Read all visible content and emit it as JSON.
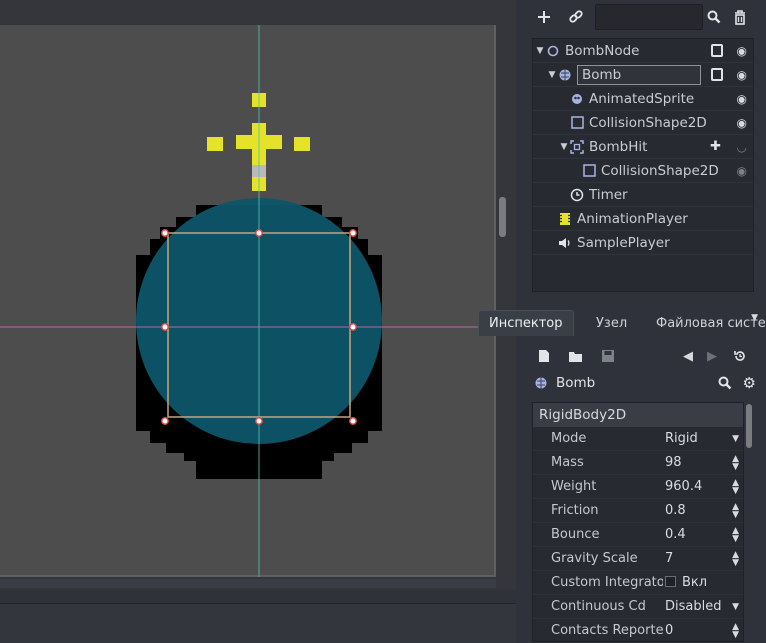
{
  "scene_tree": {
    "nodes": [
      {
        "name": "BombNode",
        "icon": "node-circle-icon",
        "has_script": true,
        "visible": true,
        "expanded": true
      },
      {
        "name": "Bomb",
        "icon": "rigidbody-globe-icon",
        "has_script": true,
        "visible": true,
        "expanded": true,
        "selected": true
      },
      {
        "name": "AnimatedSprite",
        "icon": "animated-sprite-icon",
        "visible": true
      },
      {
        "name": "CollisionShape2D",
        "icon": "collision-shape-icon",
        "visible": true
      },
      {
        "name": "BombHit",
        "icon": "area2d-icon",
        "has_lock": true,
        "visible": true,
        "expanded": true
      },
      {
        "name": "CollisionShape2D",
        "icon": "collision-shape-icon",
        "visible": true
      },
      {
        "name": "Timer",
        "icon": "timer-icon"
      },
      {
        "name": "AnimationPlayer",
        "icon": "animation-player-icon"
      },
      {
        "name": "SamplePlayer",
        "icon": "sample-player-icon"
      }
    ]
  },
  "dock_tabs": [
    {
      "label": "Инспектор",
      "active": true
    },
    {
      "label": "Узел",
      "active": false
    },
    {
      "label": "Файловая систем",
      "active": false
    }
  ],
  "inspector": {
    "object_name": "Bomb",
    "section": "RigidBody2D",
    "properties": [
      {
        "name": "Mode",
        "value": "Rigid",
        "control": "dropdown"
      },
      {
        "name": "Mass",
        "value": "98",
        "control": "spin"
      },
      {
        "name": "Weight",
        "value": "960.4",
        "control": "spin"
      },
      {
        "name": "Friction",
        "value": "0.8",
        "control": "spin"
      },
      {
        "name": "Bounce",
        "value": "0.4",
        "control": "spin"
      },
      {
        "name": "Gravity Scale",
        "value": "7",
        "control": "spin"
      },
      {
        "name": "Custom Integrato",
        "value": "Вкл",
        "control": "checkbox"
      },
      {
        "name": "Continuous Cd",
        "value": "Disabled",
        "control": "dropdown"
      },
      {
        "name": "Contacts Reporte",
        "value": "0",
        "control": "spin"
      }
    ]
  },
  "colors": {
    "canvas_bg": "#4d4d4d",
    "bomb_body": "#0c5468",
    "fuse_spark": "#e5e22a",
    "selection_rect": "#c8a57e",
    "handle_fill": "#ffffff",
    "handle_stroke": "#e0474a"
  }
}
